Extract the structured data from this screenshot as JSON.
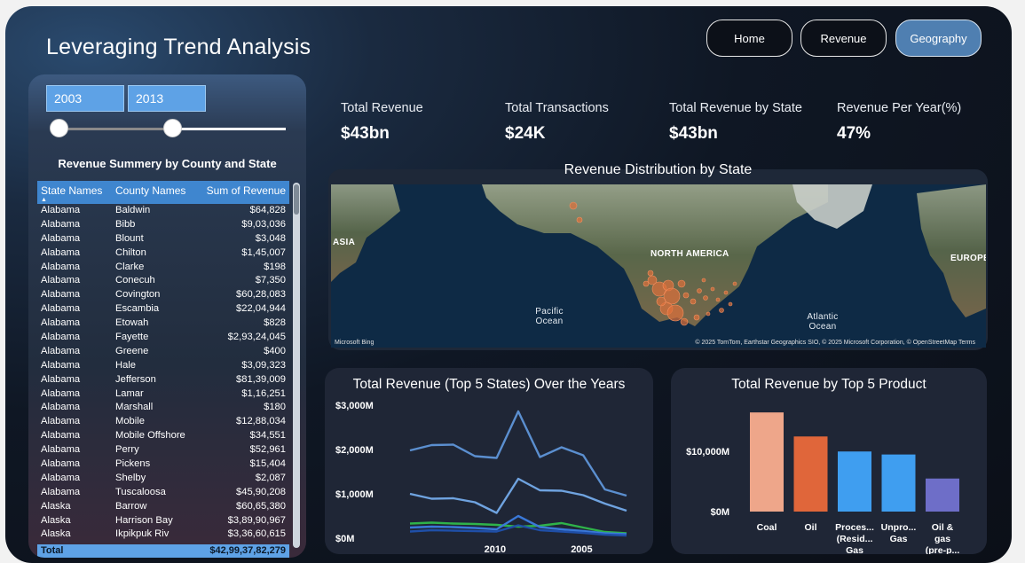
{
  "title": "Leveraging Trend Analysis",
  "nav": [
    {
      "label": "Home",
      "active": false
    },
    {
      "label": "Revenue",
      "active": false
    },
    {
      "label": "Geography",
      "active": true
    }
  ],
  "slicer": {
    "start_year": "2003",
    "end_year": "2013"
  },
  "table": {
    "title": "Revenue Summery by County and State",
    "headers": [
      "State Names",
      "County Names",
      "Sum of Revenue"
    ],
    "rows": [
      [
        "Alabama",
        "Baldwin",
        "$64,828"
      ],
      [
        "Alabama",
        "Bibb",
        "$9,03,036"
      ],
      [
        "Alabama",
        "Blount",
        "$3,048"
      ],
      [
        "Alabama",
        "Chilton",
        "$1,45,007"
      ],
      [
        "Alabama",
        "Clarke",
        "$198"
      ],
      [
        "Alabama",
        "Conecuh",
        "$7,350"
      ],
      [
        "Alabama",
        "Covington",
        "$60,28,083"
      ],
      [
        "Alabama",
        "Escambia",
        "$22,04,944"
      ],
      [
        "Alabama",
        "Etowah",
        "$828"
      ],
      [
        "Alabama",
        "Fayette",
        "$2,93,24,045"
      ],
      [
        "Alabama",
        "Greene",
        "$400"
      ],
      [
        "Alabama",
        "Hale",
        "$3,09,323"
      ],
      [
        "Alabama",
        "Jefferson",
        "$81,39,009"
      ],
      [
        "Alabama",
        "Lamar",
        "$1,16,251"
      ],
      [
        "Alabama",
        "Marshall",
        "$180"
      ],
      [
        "Alabama",
        "Mobile",
        "$12,88,034"
      ],
      [
        "Alabama",
        "Mobile Offshore",
        "$34,551"
      ],
      [
        "Alabama",
        "Perry",
        "$52,961"
      ],
      [
        "Alabama",
        "Pickens",
        "$15,404"
      ],
      [
        "Alabama",
        "Shelby",
        "$2,087"
      ],
      [
        "Alabama",
        "Tuscaloosa",
        "$45,90,208"
      ],
      [
        "Alaska",
        "Barrow",
        "$60,65,380"
      ],
      [
        "Alaska",
        "Harrison Bay",
        "$3,89,90,967"
      ],
      [
        "Alaska",
        "Ikpikpuk Riv",
        "$3,36,60,615"
      ]
    ],
    "total_label": "Total",
    "total_value": "$42,99,37,82,279"
  },
  "kpis": [
    {
      "label": "Total Revenue",
      "value": "$43bn"
    },
    {
      "label": "Total Transactions",
      "value": "$24K"
    },
    {
      "label": "Total Revenue by State",
      "value": "$43bn"
    },
    {
      "label": "Revenue Per Year(%)",
      "value": "47%"
    }
  ],
  "map": {
    "title": "Revenue Distribution by State",
    "labels": [
      "ASIA",
      "NORTH AMERICA",
      "EUROPE"
    ],
    "oceans": [
      "Pacific Ocean",
      "Atlantic Ocean"
    ],
    "logo": "Microsoft Bing",
    "attribution": "© 2025 TomTom, Earthstar Geographics SIO, © 2025 Microsoft Corporation, © OpenStreetMap Terms"
  },
  "line_chart_title": "Total Revenue (Top 5 States) Over the Years",
  "bar_chart_title": "Total Revenue by Top 5 Product",
  "chart_data": [
    {
      "type": "line",
      "title": "Total Revenue (Top 5 States) Over the Years",
      "x_ticks": [
        "2010",
        "2005"
      ],
      "y_ticks": [
        "$3,000M",
        "$2,000M",
        "$1,000M",
        "$0M"
      ],
      "ylim": [
        0,
        3000
      ],
      "x_index": [
        0,
        1,
        2,
        3,
        4,
        5,
        6,
        7,
        8,
        9,
        10
      ],
      "series": [
        {
          "color": "#5b8fd0",
          "values": [
            1980,
            2100,
            2110,
            1850,
            1810,
            2860,
            1830,
            2050,
            1870,
            1100,
            960
          ]
        },
        {
          "color": "#6fa3e0",
          "values": [
            1000,
            890,
            900,
            810,
            570,
            1340,
            1080,
            1070,
            970,
            780,
            620
          ]
        },
        {
          "color": "#2fb34a",
          "values": [
            330,
            350,
            330,
            320,
            300,
            260,
            280,
            340,
            240,
            140,
            110
          ]
        },
        {
          "color": "#3a78d8",
          "values": [
            240,
            260,
            250,
            230,
            200,
            500,
            250,
            200,
            160,
            110,
            90
          ]
        },
        {
          "color": "#1f4fa8",
          "values": [
            150,
            180,
            170,
            160,
            150,
            290,
            180,
            150,
            120,
            80,
            60
          ]
        }
      ]
    },
    {
      "type": "bar",
      "title": "Total Revenue by Top 5 Product",
      "categories": [
        "Coal",
        "Oil",
        "Proces... (Resid... Gas",
        "Unpro... Gas",
        "Oil & gas (pre-p..."
      ],
      "category_lines": [
        [
          "Coal"
        ],
        [
          "Oil"
        ],
        [
          "Proces...",
          "(Resid...",
          "Gas"
        ],
        [
          "Unpro...",
          "Gas"
        ],
        [
          "Oil &",
          "gas",
          "(pre-p..."
        ]
      ],
      "values": [
        16500,
        12500,
        10000,
        9500,
        5500
      ],
      "colors": [
        "#eea68a",
        "#e0663a",
        "#3f9ef0",
        "#3f9ef0",
        "#6e6ec8"
      ],
      "y_ticks": [
        "$10,000M",
        "$0M"
      ],
      "ylim": [
        0,
        18000
      ]
    }
  ]
}
